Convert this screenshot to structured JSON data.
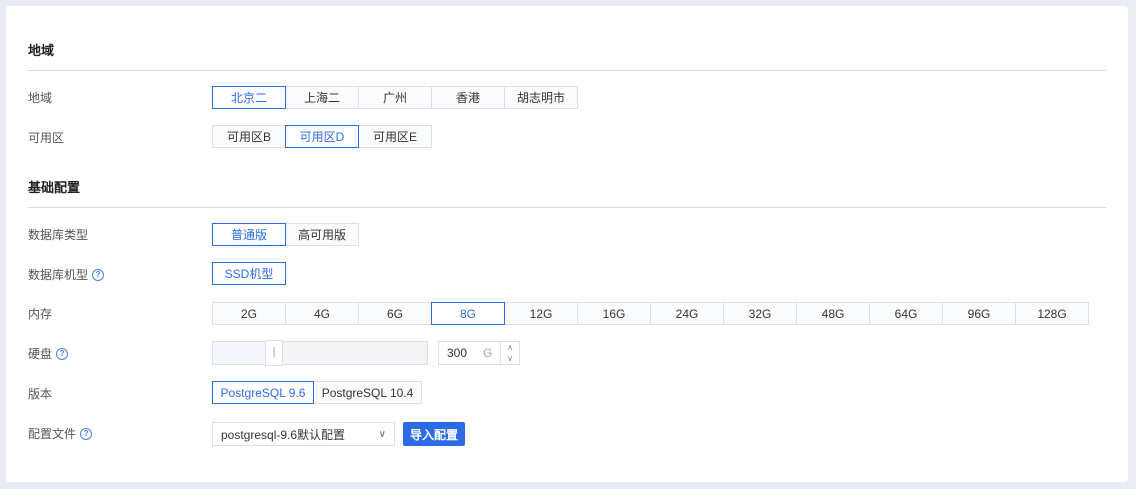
{
  "region_section": {
    "title": "地域",
    "region_label": "地域",
    "regions": [
      "北京二",
      "上海二",
      "广州",
      "香港",
      "胡志明市"
    ],
    "zone_label": "可用区",
    "zones": [
      "可用区B",
      "可用区D",
      "可用区E"
    ]
  },
  "basic_section": {
    "title": "基础配置",
    "db_type_label": "数据库类型",
    "db_types": [
      "普通版",
      "高可用版"
    ],
    "machine_label": "数据库机型",
    "machines": [
      "SSD机型"
    ],
    "memory_label": "内存",
    "memory_options": [
      "2G",
      "4G",
      "6G",
      "8G",
      "12G",
      "16G",
      "24G",
      "32G",
      "48G",
      "64G",
      "96G",
      "128G"
    ],
    "disk_label": "硬盘",
    "disk_value": "300",
    "disk_unit": "G",
    "version_label": "版本",
    "versions": [
      "PostgreSQL 9.6",
      "PostgreSQL 10.4"
    ],
    "config_label": "配置文件",
    "config_selected": "postgresql-9.6默认配置",
    "import_button": "导入配置"
  },
  "selected": {
    "region": "北京二",
    "zone": "可用区D",
    "db_type": "普通版",
    "machine": "SSD机型",
    "memory": "8G",
    "version": "PostgreSQL 9.6"
  },
  "colors": {
    "accent": "#2d6be4",
    "page_bg": "#e9ecf3"
  }
}
